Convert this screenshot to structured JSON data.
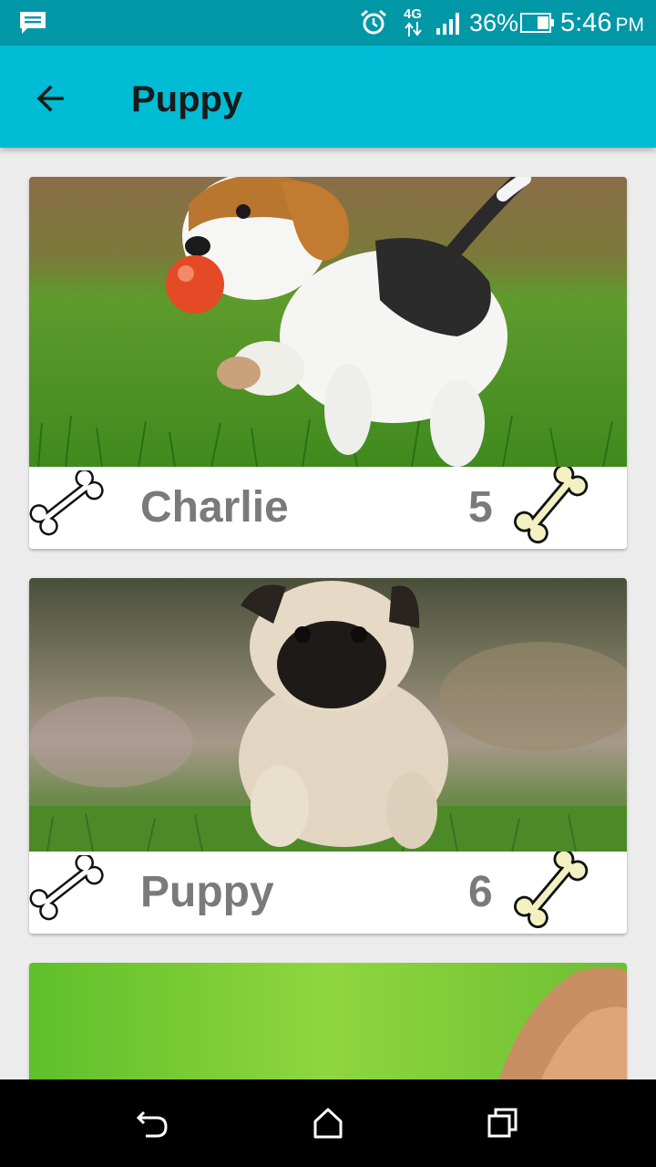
{
  "status_bar": {
    "network": "4G",
    "battery_percent": "36%",
    "time": "5:46",
    "ampm": "PM",
    "icons": [
      "message-icon",
      "alarm-icon",
      "network-arrows-icon",
      "signal-icon",
      "battery-icon"
    ]
  },
  "app_bar": {
    "title": "Puppy",
    "back_icon": "arrow-left-icon",
    "color": "#00bcd4"
  },
  "cards": [
    {
      "name": "Charlie",
      "count": "5",
      "photo": "beagle puppy with red ball"
    },
    {
      "name": "Puppy",
      "count": "6",
      "photo": "pug puppy on grass"
    }
  ],
  "nav_bar": {
    "icons": [
      "back-nav-icon",
      "home-nav-icon",
      "recents-nav-icon"
    ]
  },
  "colors": {
    "status_bar": "#0097a7",
    "app_bar": "#00bcd4",
    "background": "#ececec",
    "text_gray": "#7a7a7a",
    "bone_filled": "#f3f0c2"
  }
}
